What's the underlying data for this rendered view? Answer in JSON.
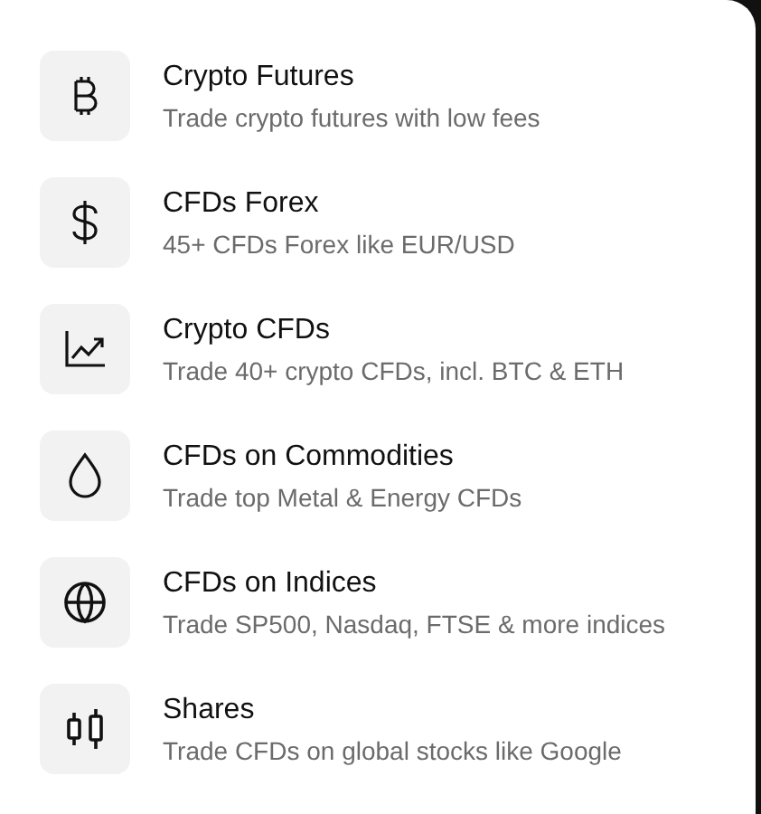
{
  "products": [
    {
      "title": "Crypto Futures",
      "subtitle": "Trade crypto futures with low fees"
    },
    {
      "title": "CFDs Forex",
      "subtitle": "45+ CFDs Forex like EUR/USD"
    },
    {
      "title": "Crypto CFDs",
      "subtitle": "Trade 40+ crypto CFDs, incl. BTC & ETH"
    },
    {
      "title": "CFDs on Commodities",
      "subtitle": "Trade top Metal & Energy CFDs"
    },
    {
      "title": "CFDs on Indices",
      "subtitle": "Trade SP500, Nasdaq, FTSE & more indices"
    },
    {
      "title": "Shares",
      "subtitle": "Trade CFDs on global stocks like Google"
    }
  ]
}
